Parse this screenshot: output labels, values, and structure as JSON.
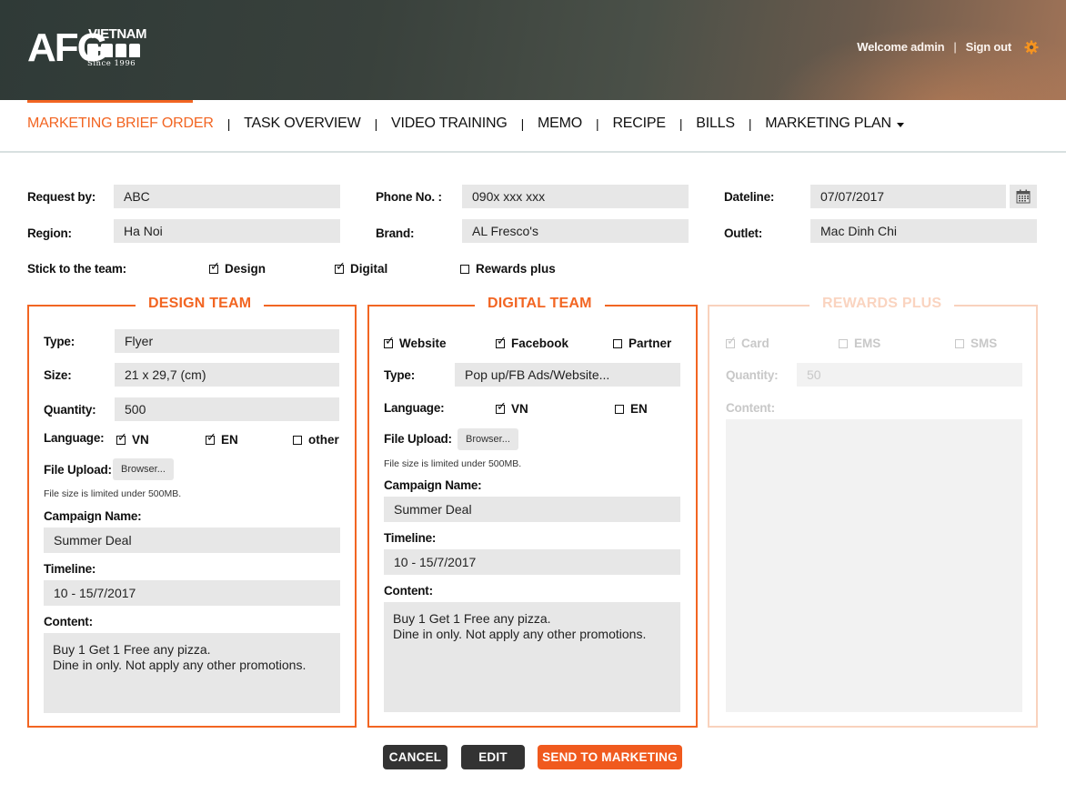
{
  "brand": {
    "logo_main": "AFG",
    "logo_country": "VIETNAM",
    "logo_since": "Since 1996"
  },
  "header": {
    "welcome": "Welcome admin",
    "separator": "|",
    "sign_out": "Sign out",
    "settings_icon": "gear-icon",
    "accent_color": "#f26522"
  },
  "nav": {
    "items": [
      {
        "label": "MARKETING BRIEF ORDER",
        "active": true
      },
      {
        "label": "TASK OVERVIEW",
        "active": false
      },
      {
        "label": "VIDEO TRAINING",
        "active": false
      },
      {
        "label": "MEMO",
        "active": false
      },
      {
        "label": "RECIPE",
        "active": false
      },
      {
        "label": "BILLS",
        "active": false
      },
      {
        "label": "MARKETING PLAN",
        "active": false,
        "dropdown": true
      }
    ],
    "divider": "|"
  },
  "form": {
    "request_by": {
      "label": "Request by:",
      "value": "ABC"
    },
    "phone": {
      "label": "Phone No. :",
      "value": "090x xxx xxx"
    },
    "dateline": {
      "label": "Dateline:",
      "value": "07/07/2017"
    },
    "region": {
      "label": "Region:",
      "value": "Ha Noi"
    },
    "brand": {
      "label": "Brand:",
      "value": "AL Fresco's"
    },
    "outlet": {
      "label": "Outlet:",
      "value": "Mac Dinh Chi"
    },
    "stick_to_team": {
      "label": "Stick to the team:",
      "options": [
        {
          "label": "Design",
          "checked": true
        },
        {
          "label": "Digital",
          "checked": true
        },
        {
          "label": "Rewards plus",
          "checked": false
        }
      ]
    }
  },
  "design_team": {
    "title": "DESIGN TEAM",
    "type": {
      "label": "Type:",
      "value": "Flyer"
    },
    "size": {
      "label": "Size:",
      "value": "21 x 29,7 (cm)"
    },
    "quantity": {
      "label": "Quantity:",
      "value": "500"
    },
    "language": {
      "label": "Language:",
      "options": [
        {
          "label": "VN",
          "checked": true
        },
        {
          "label": "EN",
          "checked": true
        },
        {
          "label": "other",
          "checked": false
        }
      ]
    },
    "file_upload": {
      "label": "File Upload:",
      "button": "Browser...",
      "note": "File size is limited under 500MB."
    },
    "campaign": {
      "label": "Campaign Name:",
      "value": "Summer Deal"
    },
    "timeline": {
      "label": "Timeline:",
      "value": "10 - 15/7/2017"
    },
    "content": {
      "label": "Content:",
      "line1": "Buy 1 Get 1 Free any pizza.",
      "line2": "Dine in only. Not apply any other promotions."
    }
  },
  "digital_team": {
    "title": "DIGITAL TEAM",
    "channels": [
      {
        "label": "Website",
        "checked": true
      },
      {
        "label": "Facebook",
        "checked": true
      },
      {
        "label": "Partner",
        "checked": false
      }
    ],
    "type": {
      "label": "Type:",
      "value": "Pop up/FB Ads/Website..."
    },
    "language": {
      "label": "Language:",
      "options": [
        {
          "label": "VN",
          "checked": true
        },
        {
          "label": "EN",
          "checked": false
        }
      ]
    },
    "file_upload": {
      "label": "File Upload:",
      "button": "Browser...",
      "note": "File size is limited under 500MB."
    },
    "campaign": {
      "label": "Campaign Name:",
      "value": "Summer Deal"
    },
    "timeline": {
      "label": "Timeline:",
      "value": "10 - 15/7/2017"
    },
    "content": {
      "label": "Content:",
      "line1": "Buy 1 Get 1 Free any pizza.",
      "line2": "Dine in only. Not apply any other promotions."
    }
  },
  "rewards_plus": {
    "title": "REWARDS PLUS",
    "channels": [
      {
        "label": "Card",
        "checked": true
      },
      {
        "label": "EMS",
        "checked": false
      },
      {
        "label": "SMS",
        "checked": false
      }
    ],
    "quantity": {
      "label": "Quantity:",
      "value": "50"
    },
    "content": {
      "label": "Content:"
    }
  },
  "actions": {
    "cancel": "CANCEL",
    "edit": "EDIT",
    "send": "SEND TO MARKETING"
  }
}
